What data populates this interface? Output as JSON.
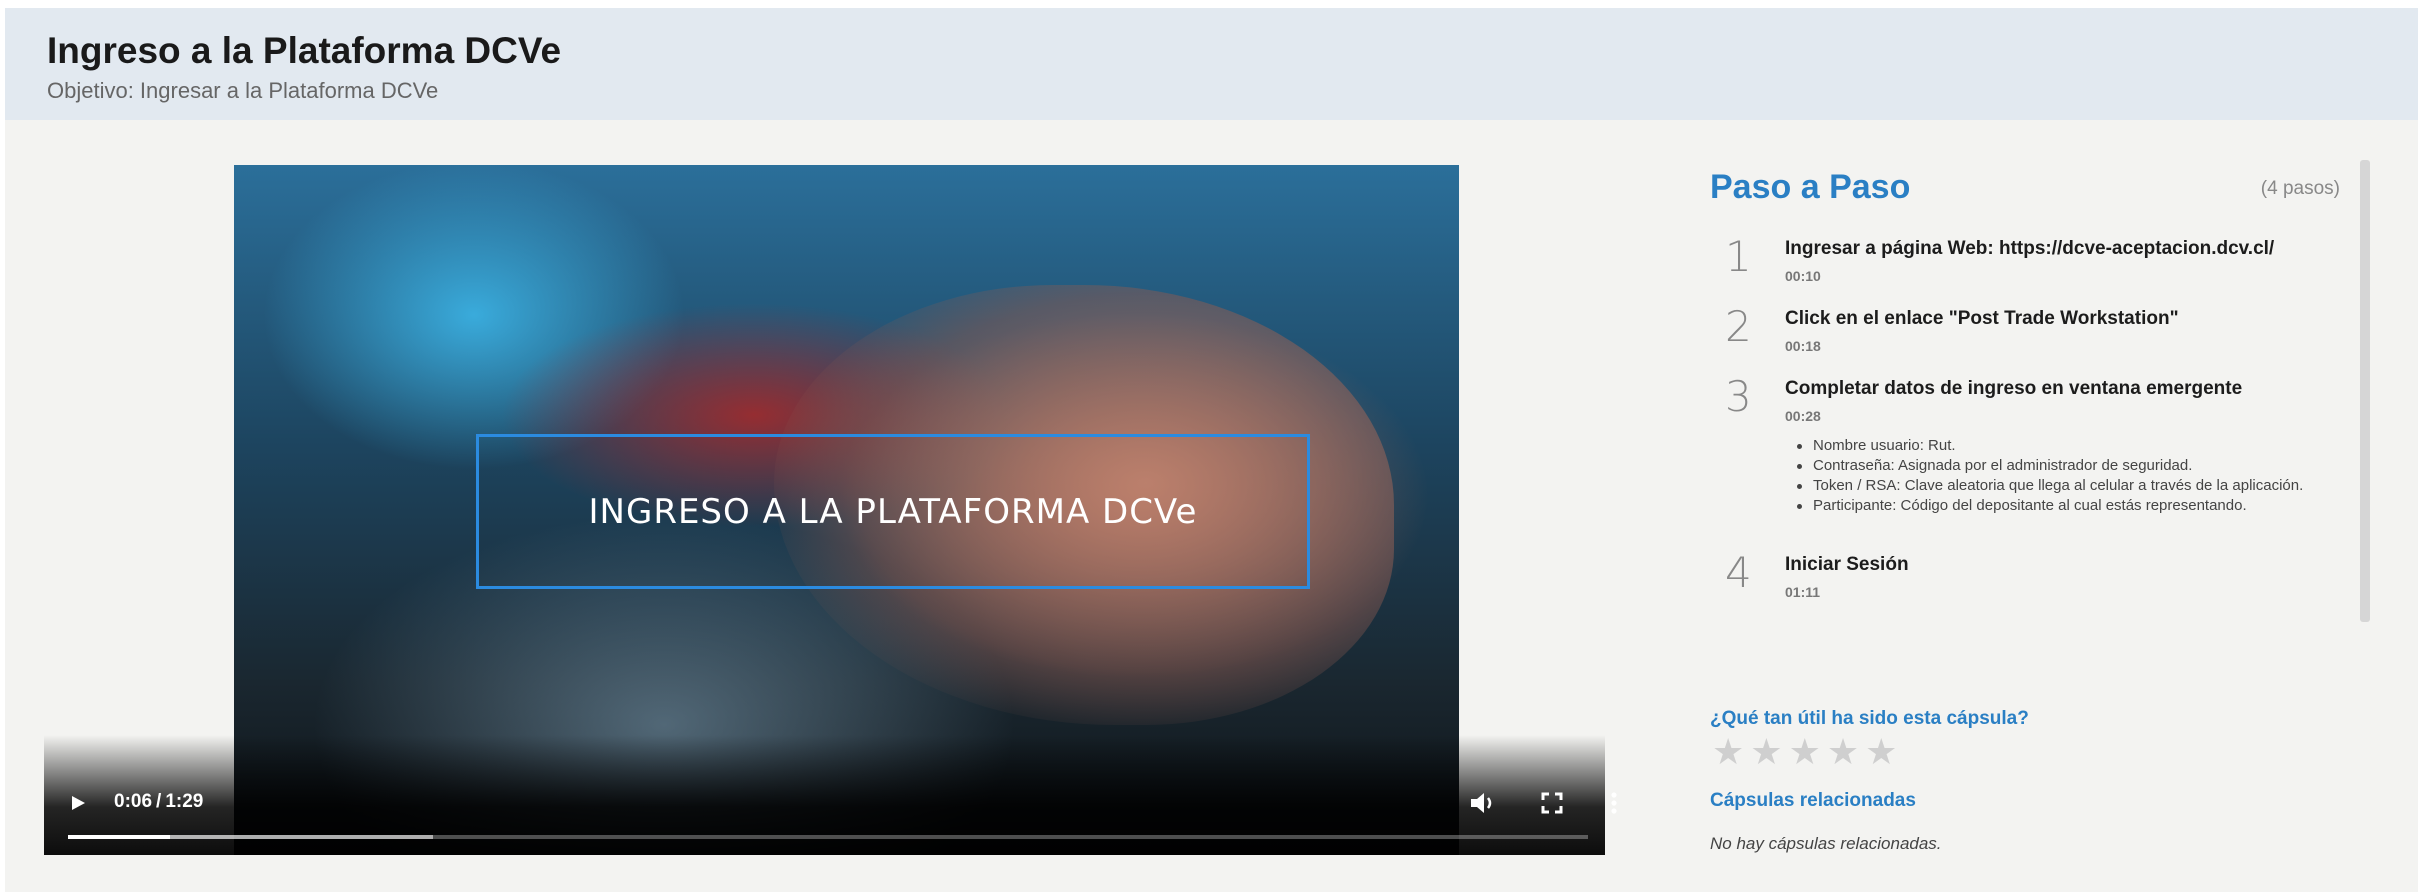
{
  "header": {
    "title": "Ingreso a la Plataforma DCVe",
    "subtitle": "Objetivo: Ingresar a la Plataforma DCVe"
  },
  "video": {
    "overlay_text": "INGRESO A LA PLATAFORMA DCVe",
    "current_time": "0:06",
    "duration": "1:29",
    "time_separator": "/",
    "progress_fraction": 0.067,
    "buffered_fraction": 0.24
  },
  "steps_panel": {
    "heading": "Paso a Paso",
    "count": "(4 pasos)",
    "steps": [
      {
        "number": "1",
        "text": "Ingresar a página Web: https://dcve-aceptacion.dcv.cl/",
        "time": "00:10"
      },
      {
        "number": "2",
        "text": "Click en el enlace \"Post Trade Workstation\"",
        "time": "00:18"
      },
      {
        "number": "3",
        "text": "Completar datos de ingreso en ventana emergente",
        "time": "00:28",
        "bullets": [
          "Nombre usuario: Rut.",
          "Contraseña: Asignada por el administrador de seguridad.",
          "Token / RSA: Clave aleatoria que llega al celular a través de la aplicación.",
          "Participante: Código del depositante al cual estás representando."
        ]
      },
      {
        "number": "4",
        "text": "Iniciar Sesión",
        "time": "01:11"
      }
    ]
  },
  "rating": {
    "question": "¿Qué tan útil ha sido esta cápsula?",
    "star_glyph": "★",
    "stars_filled": 0,
    "stars_total": 5
  },
  "related": {
    "title": "Cápsulas relacionadas",
    "empty_text": "No hay cápsulas relacionadas."
  },
  "colors": {
    "accent": "#2a7fc4",
    "header_bg": "#e2e9f0",
    "content_bg": "#f3f3f1",
    "overlay_border": "#2b8be0"
  },
  "icons": {
    "play": "play-icon",
    "volume": "volume-icon",
    "fullscreen": "fullscreen-icon",
    "more": "more-vertical-icon",
    "star": "star-icon"
  }
}
